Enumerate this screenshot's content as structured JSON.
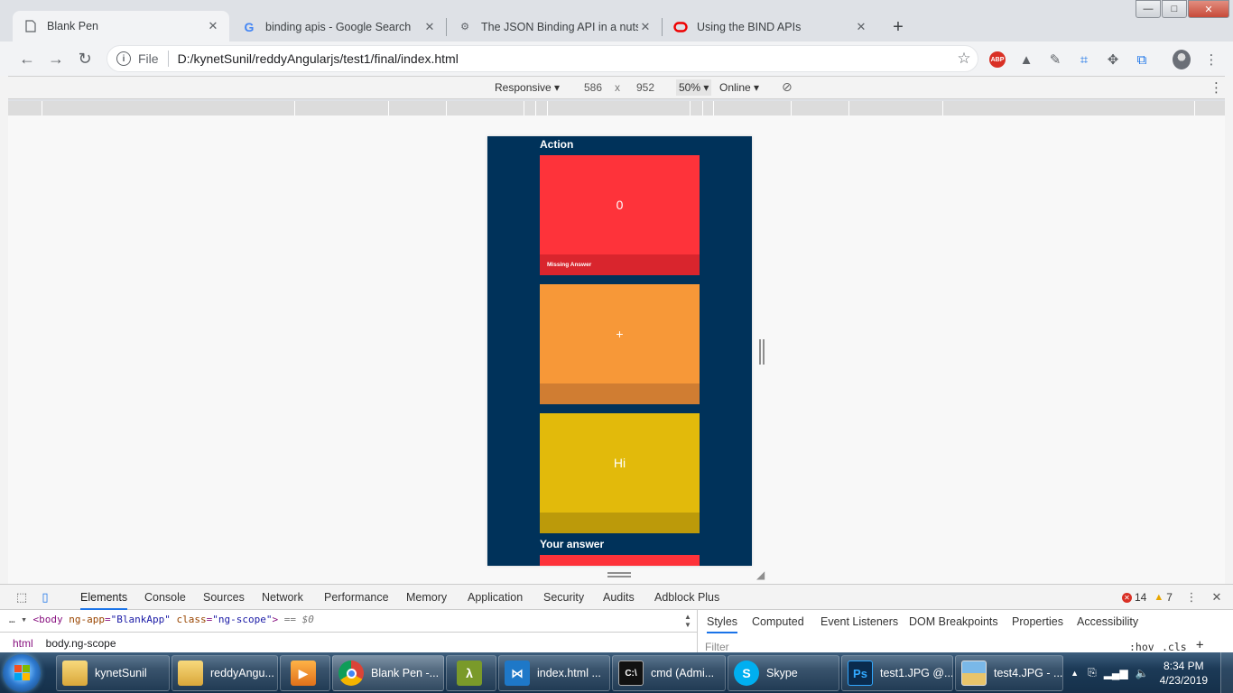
{
  "browser": {
    "tabs": [
      {
        "title": "Blank Pen",
        "active": true
      },
      {
        "title": "binding apis - Google Search",
        "active": false
      },
      {
        "title": "The JSON Binding API in a nutshell",
        "active": false
      },
      {
        "title": "Using the BIND APIs",
        "active": false
      }
    ],
    "new_tab_label": "+",
    "url_scheme": "File",
    "url": "D:/kynetSunil/reddyAngularjs/test1/final/index.html",
    "extensions": [
      "abp-icon",
      "drive-icon",
      "eyedropper-icon",
      "crop-icon",
      "puzzle-icon",
      "cast-icon"
    ],
    "abp_label": "ABP"
  },
  "device_toolbar": {
    "mode": "Responsive",
    "width": "586",
    "height": "952",
    "times": "x",
    "zoom": "50%",
    "network": "Online"
  },
  "page": {
    "action_title": "Action",
    "cards": [
      {
        "value": "0",
        "footer": "Missing Answer",
        "color": "#fe333a",
        "footer_color": "#d9252d"
      },
      {
        "value": "+",
        "footer": "",
        "color": "#f79838",
        "footer_color": "#d07d32"
      },
      {
        "value": "Hi",
        "footer": "",
        "color": "#e2ba0b",
        "footer_color": "#bc9a0a"
      }
    ],
    "answer_title": "Your answer",
    "background": "#00325a"
  },
  "devtools": {
    "tabs": [
      "Elements",
      "Console",
      "Sources",
      "Network",
      "Performance",
      "Memory",
      "Application",
      "Security",
      "Audits",
      "Adblock Plus"
    ],
    "errors": "14",
    "warnings": "7",
    "dom_line": {
      "tag_open": "<body",
      "attr1": "ng-app",
      "val1": "\"BlankApp\"",
      "attr2": "class",
      "val2": "\"ng-scope\"",
      "tag_close": ">",
      "selected_marker": "== $0"
    },
    "breadcrumbs": [
      "html",
      "body.ng-scope"
    ],
    "styles_tabs": [
      "Styles",
      "Computed",
      "Event Listeners",
      "DOM Breakpoints",
      "Properties",
      "Accessibility"
    ],
    "filter_placeholder": "Filter",
    "hov": ":hov",
    "cls": ".cls",
    "add": "+"
  },
  "taskbar": {
    "items": [
      {
        "label": "kynetSunil",
        "icon": "folder-icon"
      },
      {
        "label": "reddyAngu...",
        "icon": "folder-icon"
      },
      {
        "label": "",
        "icon": "media-player-icon"
      },
      {
        "label": "Blank Pen -...",
        "icon": "chrome-icon"
      },
      {
        "label": "",
        "icon": "lambda-icon"
      },
      {
        "label": "index.html ...",
        "icon": "vscode-icon"
      },
      {
        "label": "cmd (Admi...",
        "icon": "cmd-icon"
      },
      {
        "label": "Skype",
        "icon": "skype-icon"
      },
      {
        "label": "test1.JPG @...",
        "icon": "photoshop-icon"
      },
      {
        "label": "test4.JPG - ...",
        "icon": "photo-viewer-icon"
      }
    ],
    "time": "8:34 PM",
    "date": "4/23/2019"
  }
}
